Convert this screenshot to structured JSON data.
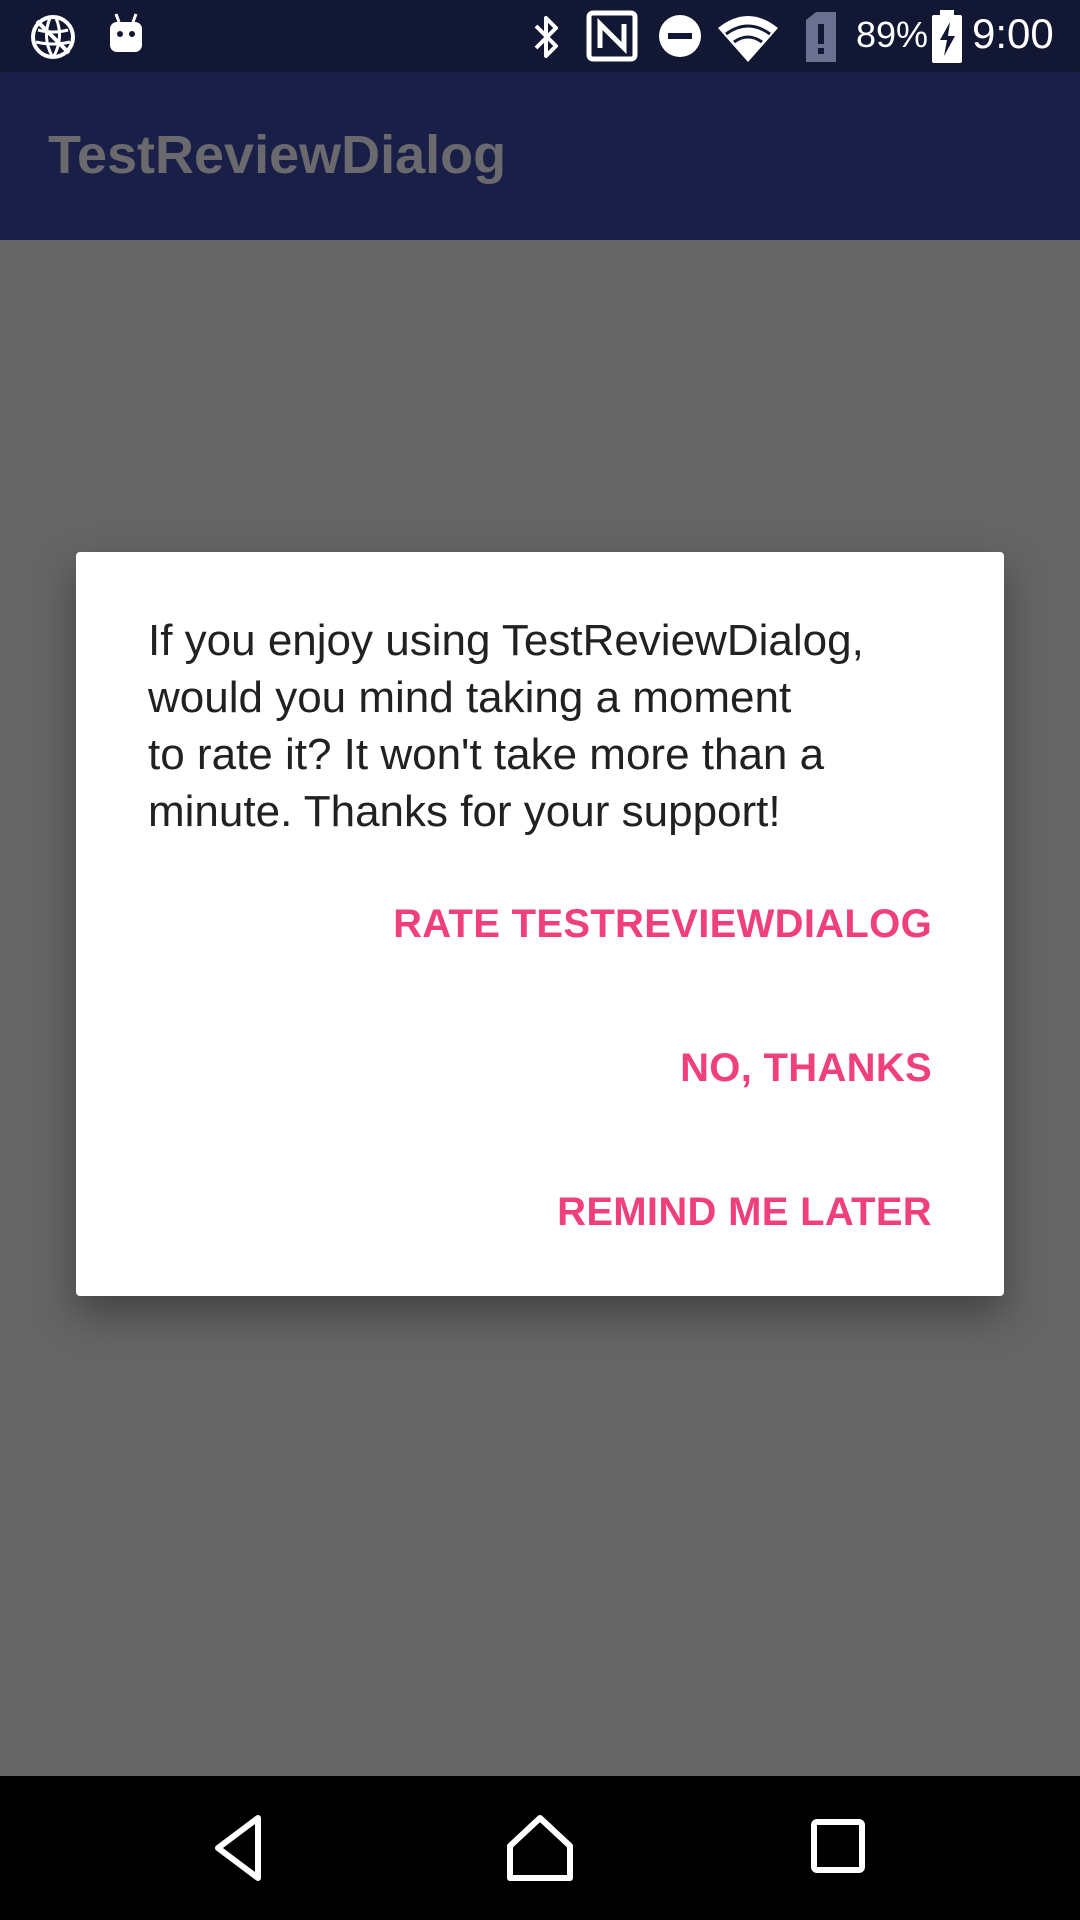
{
  "status_bar": {
    "battery_percent": "89%",
    "time": "9:00",
    "icons": [
      "vpn-globe-icon",
      "android-icon",
      "bluetooth-icon",
      "nfc-icon",
      "do-not-disturb-icon",
      "wifi-icon",
      "sim-alert-icon",
      "battery-charging-icon"
    ]
  },
  "app_bar": {
    "title": "TestReviewDialog"
  },
  "dialog": {
    "message": "If you enjoy using TestReviewDialog,\nwould you mind taking a moment\nto rate it? It won't take more than a\nminute. Thanks for your support!",
    "buttons": {
      "rate": "RATE TESTREVIEWDIALOG",
      "no_thanks": "NO, THANKS",
      "remind_later": "REMIND ME LATER"
    }
  },
  "colors": {
    "status_bar_bg": "#121833",
    "app_bar_bg": "#1a1f47",
    "accent": "#f0407b",
    "scrim": "#656565",
    "nav_bar_bg": "#000000"
  },
  "nav_bar": {
    "icons": [
      "back-icon",
      "home-icon",
      "recents-icon"
    ]
  }
}
